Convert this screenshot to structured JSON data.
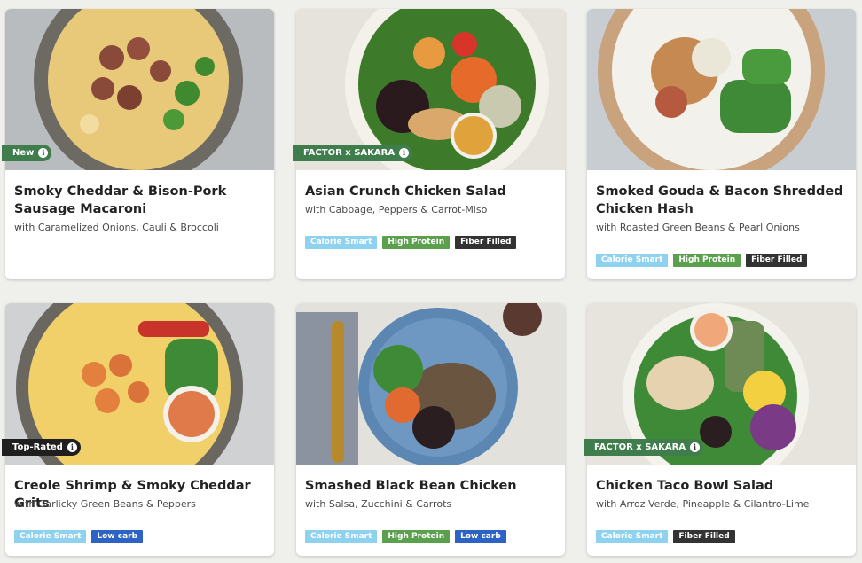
{
  "colors": {
    "green": "#3f7d4d",
    "dark": "#1f1f1f",
    "calorie_smart": "#8fd2ef",
    "high_protein": "#5aa04d",
    "fiber_filled": "#333333",
    "low_carb": "#2d63c4"
  },
  "info_icon": "i",
  "meals": [
    {
      "title": "Smoky Cheddar & Bison-Pork Sausage Macaroni",
      "subtitle": "with Caramelized Onions, Cauli & Broccoli",
      "badge": "New",
      "tags": []
    },
    {
      "title": "Asian Crunch Chicken Salad",
      "subtitle": "with Cabbage, Peppers & Carrot-Miso",
      "badge": "FACTOR x SAKARA",
      "tags": [
        "Calorie Smart",
        "High Protein",
        "Fiber Filled"
      ]
    },
    {
      "title": "Smoked Gouda & Bacon Shredded Chicken Hash",
      "subtitle": "with Roasted Green Beans & Pearl Onions",
      "badge": "",
      "tags": [
        "Calorie Smart",
        "High Protein",
        "Fiber Filled"
      ]
    },
    {
      "title": "Creole Shrimp & Smoky Cheddar Grits",
      "subtitle": "with Garlicky Green Beans & Peppers",
      "badge": "Top-Rated",
      "tags": [
        "Calorie Smart",
        "Low carb"
      ]
    },
    {
      "title": "Smashed Black Bean Chicken",
      "subtitle": "with Salsa, Zucchini & Carrots",
      "badge": "",
      "tags": [
        "Calorie Smart",
        "High Protein",
        "Low carb"
      ]
    },
    {
      "title": "Chicken Taco Bowl Salad",
      "subtitle": "with Arroz Verde, Pineapple & Cilantro-Lime",
      "badge": "FACTOR x SAKARA",
      "tags": [
        "Calorie Smart",
        "Fiber Filled"
      ]
    }
  ]
}
